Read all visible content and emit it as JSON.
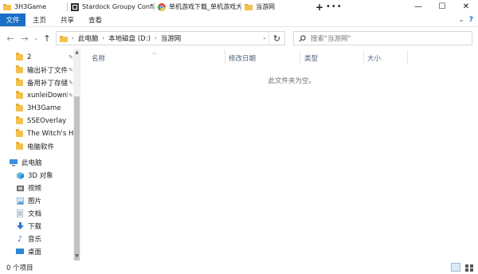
{
  "tabs": [
    {
      "label": "3H3Game",
      "icon": "folder-icon"
    },
    {
      "label": "Stardock Groupy Confi...",
      "icon": "stardock-icon"
    },
    {
      "label": "单机游戏下载_单机游戏大...",
      "icon": "chrome-icon"
    },
    {
      "label": "当游网",
      "icon": "folder-icon"
    }
  ],
  "window_controls": {
    "plus": "+",
    "more": "•••",
    "minimize": "—",
    "maximize": "☐",
    "close": "✕"
  },
  "ribbon": {
    "tabs": [
      "文件",
      "主页",
      "共享",
      "查看"
    ]
  },
  "breadcrumb": [
    "此电脑",
    "本地磁盘 (D:)",
    "当游网"
  ],
  "search": {
    "placeholder": "搜索\"当游网\""
  },
  "sidebar": {
    "items": [
      {
        "label": "2",
        "icon": "folder-icon",
        "pinned": true
      },
      {
        "label": "输出补丁文件",
        "icon": "folder-icon",
        "pinned": true
      },
      {
        "label": "备用补丁存储",
        "icon": "folder-icon",
        "pinned": true
      },
      {
        "label": "xunleiDownl",
        "icon": "folder-icon",
        "pinned": true
      },
      {
        "label": "3H3Game",
        "icon": "folder-icon",
        "pinned": false
      },
      {
        "label": "SSEOverlay",
        "icon": "folder-icon",
        "pinned": false
      },
      {
        "label": "The Witch's Ho",
        "icon": "folder-icon",
        "pinned": false
      },
      {
        "label": "电脑软件",
        "icon": "folder-icon",
        "pinned": false
      },
      {
        "label": "此电脑",
        "icon": "pc-icon",
        "pinned": false
      },
      {
        "label": "3D 对象",
        "icon": "3d-objects-icon",
        "pinned": false
      },
      {
        "label": "视频",
        "icon": "video-icon",
        "pinned": false
      },
      {
        "label": "图片",
        "icon": "pictures-icon",
        "pinned": false
      },
      {
        "label": "文档",
        "icon": "documents-icon",
        "pinned": false
      },
      {
        "label": "下载",
        "icon": "download-icon",
        "pinned": false
      },
      {
        "label": "音乐",
        "icon": "music-icon",
        "pinned": false
      },
      {
        "label": "桌面",
        "icon": "desktop-icon",
        "pinned": false
      }
    ]
  },
  "columns": [
    "名称",
    "修改日期",
    "类型",
    "大小"
  ],
  "empty_message": "此文件夹为空。",
  "status": {
    "item_count": "0 个项目"
  },
  "colors": {
    "accent": "#1a6fc4",
    "folder": "#f3c24e"
  }
}
